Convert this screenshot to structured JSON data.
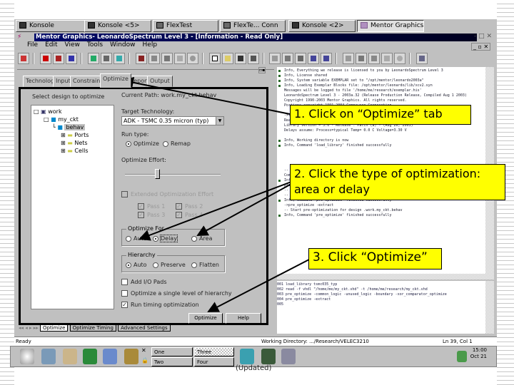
{
  "taskbar": {
    "tabs": [
      "Konsole",
      "Konsole <5>",
      "FlexTest",
      "FlexTe... Conn",
      "Konsole <2>",
      "Mentor Graphics-..."
    ]
  },
  "window": {
    "title": "Mentor Graphics- LeonardoSpectrum Level 3 - [Information - Read Only]"
  },
  "menu": [
    "File",
    "Edit",
    "View",
    "Tools",
    "Window",
    "Help"
  ],
  "panel": {
    "tabs": [
      "Technology",
      "Input",
      "Constraints",
      "Optimize",
      "Report",
      "Output"
    ],
    "active_tab": "Optimize",
    "select_label": "Select design to optimize",
    "tree": [
      "work",
      "my_ckt",
      "behav",
      "Ports",
      "Nets",
      "Cells"
    ],
    "current_path": "Current Path: work.my_ckt.behav",
    "target_tech_label": "Target Technology:",
    "target_tech_value": "ADK - TSMC 0.35 micron (typ)",
    "run_type_label": "Run type:",
    "run_types": [
      "Optimize",
      "Remap"
    ],
    "effort_label": "Optimize Effort:",
    "effort_level": 0.33,
    "extended_label": "Extended Optimization Effort",
    "passes": [
      "Pass 1",
      "Pass 2",
      "Pass 3",
      "Pass 4"
    ],
    "optimize_for_label": "Optimize For",
    "optimize_for": [
      "Auto",
      "Delay",
      "Area"
    ],
    "optimize_for_selected": "Delay",
    "hierarchy_label": "Hierarchy",
    "hierarchy": [
      "Auto",
      "Preserve",
      "Flatten"
    ],
    "add_io": "Add I/O Pads",
    "single_level": "Optimize a single level of hierarchy",
    "run_timing": "Run timing optimization",
    "optimize_button": "Optimize",
    "help_button": "Help",
    "sheet_tabs": [
      "Optimize",
      "Optimize Timing",
      "Advanced Settings"
    ]
  },
  "log": {
    "lines": [
      "Info, Everything we release is licensed to you by LeonardoSpectrum Level 3",
      "Info, License shared",
      "Info, System variable EXEMPLAR set to \"/opt/mentor/leonardo2003a\"",
      "Info, Loading Exemplar Blocks file: /opt/mentor/leonardo/lib/xcv2.syn",
      "Messages will be logged to file '/home/me/research/exemplar.his'",
      "LeonardoSpectrum Level 3 - 2003a.32 (Release Production Release, Compiled Aug 1 2003)",
      "Copyright 1990-2003 Mentor Graphics. All rights reserved.",
      "Portions copyright 1991-2004 Compuware Corporation",
      "",
      "->load_library tsmc035_typ",
      "Reading library file `/opt/mentor/adk/tsmc035/tsmc035_typ.syn`...",
      "Library version = 3.0 - Release : Patch (a) - (Aug 26, 2003)",
      "Delays assume: Process=typical Temp= 0.0 C Voltage=3.30 V",
      "",
      "Info, Working directory is now",
      "Info, Command 'load_library' finished successfully",
      "",
      "",
      "",
      "",
      "-- Reading vhdl file",
      "   Compiling root entity my_ckt(behav)",
      "Info, Command 'read' finished successfully",
      "pre_optimize -common_logic -unused_logic -boundary -xor_comparator_optimize",
      "-- Boundary optimization",
      "-- Start pre-optimization for design .work.my_ckt.behav",
      "Info, Command 'pre_optimize' finished successfully",
      "->pre_optimize -extract",
      "-- Start pre-optimization for design .work.my_ckt.behav",
      "Info, Command 'pre_optimize' finished successfully"
    ],
    "history": [
      "001 load_library tsmc035_typ",
      "002 read -f vhdl \"/home/me/my_ckt.vhd\" -t /home/me/research/my_ckt.vhd",
      "003 pre_optimize -common_logic -unused_logic -boundary -xor_comparator_optimize",
      "004 pre_optimize -extract",
      "005"
    ]
  },
  "status": {
    "ready": "Ready",
    "working_dir": "Working Directory: .../Research/VELEC3210",
    "position": "Ln 39, Col 1"
  },
  "kpanel": {
    "desktops": [
      "One",
      "Two",
      "Three",
      "Four"
    ],
    "clock_time": "15:00",
    "clock_date": "Oct 21"
  },
  "caption": "(Updated)",
  "callouts": [
    "1. Click on “Optimize” tab",
    "2. Click the type of optimization: area or delay",
    "3. Click “Optimize”"
  ],
  "colors": {
    "titlebar": "#000a6a",
    "callout": "#ffff00",
    "panel": "#c0c0c0"
  }
}
